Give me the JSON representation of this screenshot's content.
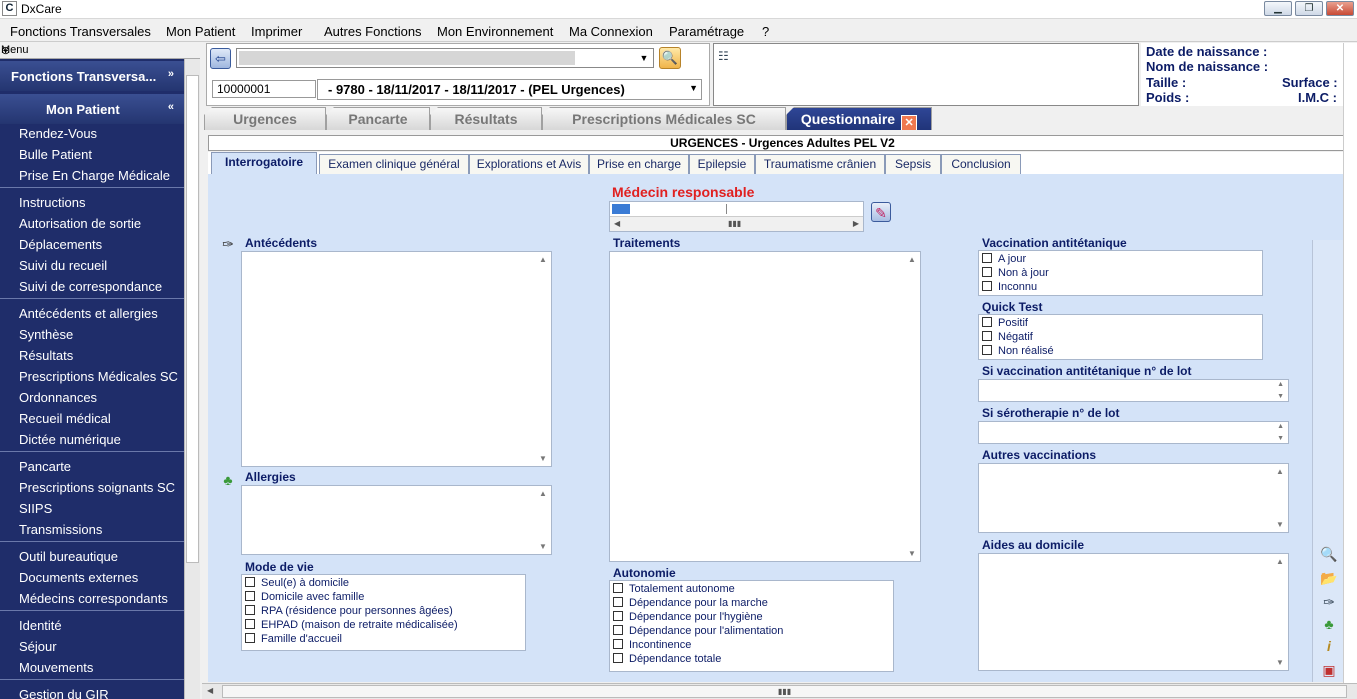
{
  "window": {
    "title": "DxCare",
    "icon_letter": "C",
    "minimize": "▁",
    "restore": "❐",
    "close": "✕"
  },
  "menu": [
    "Fonctions Transversales",
    "Mon Patient",
    "Imprimer",
    "Autres Fonctions",
    "Mon Environnement",
    "Ma Connexion",
    "Paramétrage",
    "?"
  ],
  "sidebar": {
    "header": "Menu",
    "pin": "⊕",
    "group_transversal": {
      "label": "Fonctions Transversa...",
      "chevron": "»"
    },
    "group_patient": {
      "label": "Mon Patient",
      "chevron": "«"
    },
    "links": [
      "Rendez-Vous",
      "Bulle Patient",
      "Prise En Charge Médicale",
      "Instructions",
      "Autorisation de sortie",
      "Déplacements",
      "Suivi du recueil",
      "Suivi de correspondance",
      "Antécédents et allergies",
      "Synthèse",
      "Résultats",
      "Prescriptions Médicales SC",
      "Ordonnances",
      "Recueil médical",
      "Dictée numérique",
      "Pancarte",
      "Prescriptions soignants SC",
      "SIIPS",
      "Transmissions",
      "Outil bureautique",
      "Documents externes",
      "Médecins correspondants",
      "Identité",
      "Séjour",
      "Mouvements",
      "Gestion du GIR"
    ]
  },
  "patient": {
    "ipp": "10000001",
    "sejour": "- 9780 - 18/11/2017 - 18/11/2017 - (PEL Urgences)",
    "date_naissance": "Date de naissance :",
    "nom_naissance": "Nom de naissance :",
    "taille": "Taille :",
    "surface": "Surface :",
    "poids": "Poids :",
    "imc": "I.M.C :"
  },
  "main_tabs": {
    "urgences": "Urgences",
    "pancarte": "Pancarte",
    "resultats": "Résultats",
    "prescriptions": "Prescriptions Médicales SC",
    "questionnaire": "Questionnaire"
  },
  "form": {
    "title": "URGENCES - Urgences Adultes PEL V2",
    "subtabs": [
      "Interrogatoire",
      "Examen clinique général",
      "Explorations et Avis",
      "Prise en charge",
      "Epilepsie",
      "Traumatisme crânien",
      "Sepsis",
      "Conclusion"
    ],
    "medecin_label": "Médecin responsable",
    "antecedents": "Antécédents",
    "allergies": "Allergies",
    "traitements": "Traitements",
    "mode_de_vie": {
      "label": "Mode de vie",
      "options": [
        "Seul(e) à domicile",
        "Domicile avec famille",
        "RPA (résidence pour personnes âgées)",
        "EHPAD (maison de retraite médicalisée)",
        "Famille d'accueil"
      ]
    },
    "autonomie": {
      "label": "Autonomie",
      "options": [
        "Totalement autonome",
        "Dépendance pour la marche",
        "Dépendance pour l'hygiène",
        "Dépendance pour l'alimentation",
        "Incontinence",
        "Dépendance totale"
      ]
    },
    "vaccination": {
      "label": "Vaccination antitétanique",
      "options": [
        "A jour",
        "Non à jour",
        "Inconnu"
      ]
    },
    "quick_test": {
      "label": "Quick Test",
      "options": [
        "Positif",
        "Négatif",
        "Non réalisé"
      ]
    },
    "lot_vaccin": "Si vaccination antitétanique n° de lot",
    "lot_sero": "Si sérotherapie n° de lot",
    "autres_vaccinations": "Autres vaccinations",
    "aides_domicile": "Aides au domicile"
  }
}
